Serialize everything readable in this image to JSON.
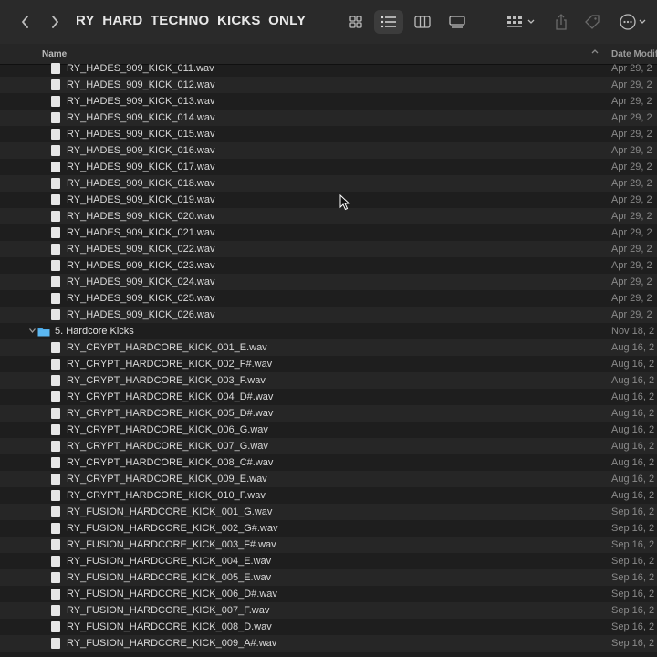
{
  "window": {
    "title": "RY_HARD_TECHNO_KICKS_ONLY",
    "icons": {
      "back": "chevron-left-icon",
      "forward": "chevron-right-icon",
      "view_icons": "grid-view-icon",
      "view_list": "list-view-icon",
      "view_columns": "column-view-icon",
      "view_gallery": "gallery-view-icon",
      "group": "group-by-icon",
      "share": "share-icon",
      "tag": "tag-icon",
      "more": "more-actions-icon"
    }
  },
  "columns": {
    "name": "Name",
    "date": "Date Modified"
  },
  "rows": [
    {
      "name": "RY_HADES_909_KICK_011.wav",
      "date": "Apr 29, 2"
    },
    {
      "name": "RY_HADES_909_KICK_012.wav",
      "date": "Apr 29, 2"
    },
    {
      "name": "RY_HADES_909_KICK_013.wav",
      "date": "Apr 29, 2"
    },
    {
      "name": "RY_HADES_909_KICK_014.wav",
      "date": "Apr 29, 2"
    },
    {
      "name": "RY_HADES_909_KICK_015.wav",
      "date": "Apr 29, 2"
    },
    {
      "name": "RY_HADES_909_KICK_016.wav",
      "date": "Apr 29, 2"
    },
    {
      "name": "RY_HADES_909_KICK_017.wav",
      "date": "Apr 29, 2"
    },
    {
      "name": "RY_HADES_909_KICK_018.wav",
      "date": "Apr 29, 2"
    },
    {
      "name": "RY_HADES_909_KICK_019.wav",
      "date": "Apr 29, 2"
    },
    {
      "name": "RY_HADES_909_KICK_020.wav",
      "date": "Apr 29, 2"
    },
    {
      "name": "RY_HADES_909_KICK_021.wav",
      "date": "Apr 29, 2"
    },
    {
      "name": "RY_HADES_909_KICK_022.wav",
      "date": "Apr 29, 2"
    },
    {
      "name": "RY_HADES_909_KICK_023.wav",
      "date": "Apr 29, 2"
    },
    {
      "name": "RY_HADES_909_KICK_024.wav",
      "date": "Apr 29, 2"
    },
    {
      "name": "RY_HADES_909_KICK_025.wav",
      "date": "Apr 29, 2"
    },
    {
      "name": "RY_HADES_909_KICK_026.wav",
      "date": "Apr 29, 2"
    },
    {
      "name": "5. Hardcore Kicks",
      "date": "Nov 18, 2",
      "folder": true
    },
    {
      "name": "RY_CRYPT_HARDCORE_KICK_001_E.wav",
      "date": "Aug 16, 2"
    },
    {
      "name": "RY_CRYPT_HARDCORE_KICK_002_F#.wav",
      "date": "Aug 16, 2"
    },
    {
      "name": "RY_CRYPT_HARDCORE_KICK_003_F.wav",
      "date": "Aug 16, 2"
    },
    {
      "name": "RY_CRYPT_HARDCORE_KICK_004_D#.wav",
      "date": "Aug 16, 2"
    },
    {
      "name": "RY_CRYPT_HARDCORE_KICK_005_D#.wav",
      "date": "Aug 16, 2"
    },
    {
      "name": "RY_CRYPT_HARDCORE_KICK_006_G.wav",
      "date": "Aug 16, 2"
    },
    {
      "name": "RY_CRYPT_HARDCORE_KICK_007_G.wav",
      "date": "Aug 16, 2"
    },
    {
      "name": "RY_CRYPT_HARDCORE_KICK_008_C#.wav",
      "date": "Aug 16, 2"
    },
    {
      "name": "RY_CRYPT_HARDCORE_KICK_009_E.wav",
      "date": "Aug 16, 2"
    },
    {
      "name": "RY_CRYPT_HARDCORE_KICK_010_F.wav",
      "date": "Aug 16, 2"
    },
    {
      "name": "RY_FUSION_HARDCORE_KICK_001_G.wav",
      "date": "Sep 16, 2"
    },
    {
      "name": "RY_FUSION_HARDCORE_KICK_002_G#.wav",
      "date": "Sep 16, 2"
    },
    {
      "name": "RY_FUSION_HARDCORE_KICK_003_F#.wav",
      "date": "Sep 16, 2"
    },
    {
      "name": "RY_FUSION_HARDCORE_KICK_004_E.wav",
      "date": "Sep 16, 2"
    },
    {
      "name": "RY_FUSION_HARDCORE_KICK_005_E.wav",
      "date": "Sep 16, 2"
    },
    {
      "name": "RY_FUSION_HARDCORE_KICK_006_D#.wav",
      "date": "Sep 16, 2"
    },
    {
      "name": "RY_FUSION_HARDCORE_KICK_007_F.wav",
      "date": "Sep 16, 2"
    },
    {
      "name": "RY_FUSION_HARDCORE_KICK_008_D.wav",
      "date": "Sep 16, 2"
    },
    {
      "name": "RY_FUSION_HARDCORE_KICK_009_A#.wav",
      "date": "Sep 16, 2"
    }
  ]
}
